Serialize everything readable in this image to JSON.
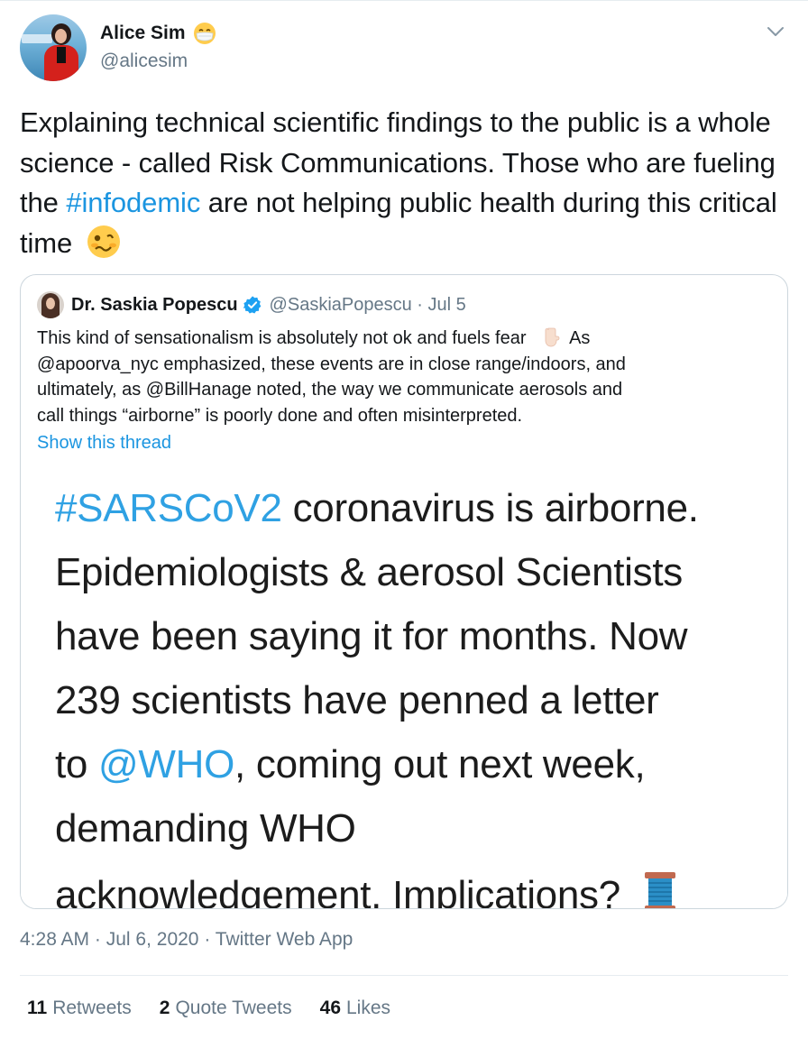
{
  "author": {
    "display_name": "Alice Sim",
    "name_emoji_icon": "face-with-medical-mask-icon",
    "handle": "@alicesim"
  },
  "tweet": {
    "text_before_hashtag": "Explaining technical scientific findings to the public is a whole science - called Risk Communications. Those who are fueling the ",
    "hashtag": "#infodemic",
    "text_after_hashtag": " are not helping public health during this critical time",
    "end_emoji_icon": "woozy-face-icon"
  },
  "quoted_tweet": {
    "display_name": "Dr. Saskia Popescu",
    "verified_icon": "verified-badge-icon",
    "handle_and_time": "@SaskiaPopescu · Jul 5",
    "text_lines": [
      "This kind of sensationalism is absolutely not ok and fuels fear",
      "@apoorva_nyc emphasized, these events are in close range/indoors, and",
      "ultimately, as @BillHanage noted, the way we communicate aerosols and",
      "call things “airborne” is poorly done and often misinterpreted."
    ],
    "line1_after_emoji": "As",
    "emoji_icon": "pointing-down-hand-icon",
    "show_thread": "Show this thread",
    "image_text": {
      "line1_link": "#SARSCoV2",
      "line1_rest": " coronavirus is airborne.",
      "line2": "Epidemiologists & aerosol Scientists",
      "line3": "have been saying it for months. Now",
      "line4": "239 scientists have penned a letter",
      "line5_before": "to ",
      "line5_link": "@WHO",
      "line5_after": ", coming out next week,",
      "line6": "demanding WHO",
      "line7": "acknowledgement. Implications?",
      "line7_emoji_icon": "thread-spool-icon"
    }
  },
  "meta": {
    "time": "4:28 AM",
    "separator": " · ",
    "date": "Jul 6, 2020",
    "source": "Twitter Web App"
  },
  "stats": {
    "retweets_count": "11",
    "retweets_label": "Retweets",
    "quotes_count": "2",
    "quotes_label": "Quote Tweets",
    "likes_count": "46",
    "likes_label": "Likes"
  },
  "colors": {
    "link": "#1b95e0",
    "secondary_text": "#657786",
    "border": "#ccd6dd"
  }
}
